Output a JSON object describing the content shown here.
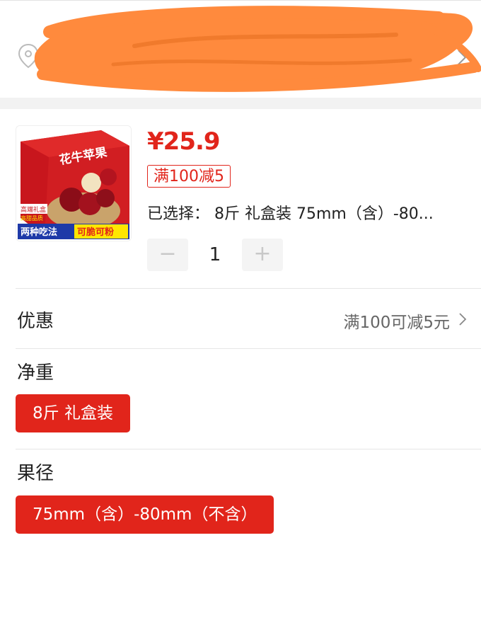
{
  "product": {
    "price": "¥25.9",
    "promo_tag": "满100减5",
    "selected_label": "已选择：",
    "selected_value": "8斤 礼盒装 75mm（含）-80...",
    "quantity": "1",
    "image_text": {
      "box_title": "花牛苹果",
      "badge_top": "高端礼盒",
      "badge_bottom": "高甜品质",
      "banner_left": "两种吃法",
      "banner_right": "可脆可粉"
    }
  },
  "stepper": {
    "minus": "−",
    "plus": "+"
  },
  "discount": {
    "label": "优惠",
    "value": "满100可减5元"
  },
  "spec_weight": {
    "title": "净重",
    "options": [
      "8斤 礼盒装"
    ]
  },
  "spec_size": {
    "title": "果径",
    "options": [
      "75mm（含）-80mm（不含）"
    ]
  },
  "colors": {
    "accent": "#e1251b",
    "scribble": "#ff8a3d"
  },
  "icons": {
    "location": "location-pin-icon",
    "chevron": "chevron-right-icon"
  }
}
